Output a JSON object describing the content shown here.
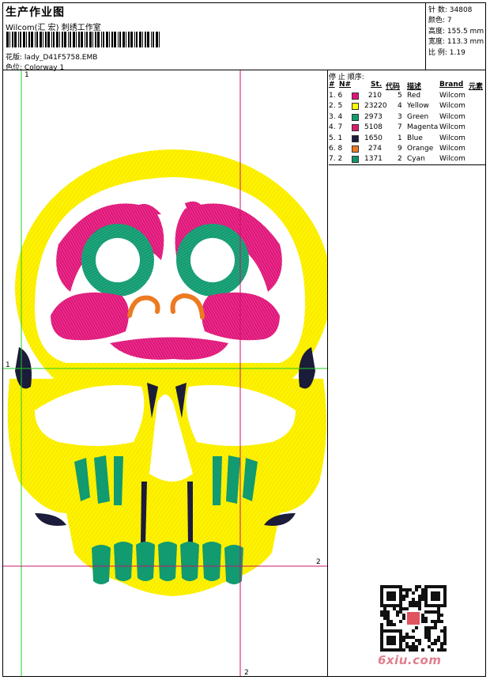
{
  "header": {
    "title": "生产作业图",
    "subtitle": "Wilcom(汇 宏) 刺绣工作室",
    "design_label": "花版:",
    "design_file": "lady_D41F5758.EMB",
    "colorway_label": "色位:",
    "colorway": "Colorway 1"
  },
  "stats": {
    "stitches_label": "针 数:",
    "stitches": "34808",
    "colors_label": "颜色:",
    "colors": "7",
    "height_label": "高度:",
    "height": "155.5 mm",
    "width_label": "宽度:",
    "width": "113.3 mm",
    "scale_label": "比 例:",
    "scale": "1.19"
  },
  "stop_sequence": {
    "title": "停 止 顺序:",
    "columns": [
      "#",
      "N#",
      "St.",
      "代码",
      "描述",
      "Brand",
      "元素"
    ],
    "rows": [
      {
        "idx": "1. 6",
        "color": "#e0157a",
        "stitches": "210",
        "code": "5",
        "desc": "Red",
        "brand": "Wilcom"
      },
      {
        "idx": "2. 5",
        "color": "#ffff00",
        "stitches": "23220",
        "code": "4",
        "desc": "Yellow",
        "brand": "Wilcom"
      },
      {
        "idx": "3. 4",
        "color": "#129a70",
        "stitches": "2973",
        "code": "3",
        "desc": "Green",
        "brand": "Wilcom"
      },
      {
        "idx": "4. 7",
        "color": "#d81b6a",
        "stitches": "5108",
        "code": "7",
        "desc": "Magenta",
        "brand": "Wilcom"
      },
      {
        "idx": "5. 1",
        "color": "#1b1b3a",
        "stitches": "1650",
        "code": "1",
        "desc": "Blue",
        "brand": "Wilcom"
      },
      {
        "idx": "6. 8",
        "color": "#ec7a22",
        "stitches": "274",
        "code": "9",
        "desc": "Orange",
        "brand": "Wilcom"
      },
      {
        "idx": "7. 2",
        "color": "#11936e",
        "stitches": "1371",
        "code": "2",
        "desc": "Cyan",
        "brand": "Wilcom"
      }
    ]
  },
  "guides": {
    "top_label": "1",
    "left_label": "1",
    "right_label": "2",
    "bottom_label": "2"
  },
  "watermark": {
    "site": "6xiu.com"
  },
  "colors": {
    "yellow": "#fff200",
    "magenta": "#e0157a",
    "green": "#129a70",
    "orange": "#ec7a22",
    "dark": "#1b1b3a",
    "guide_green": "#22cc22",
    "guide_magenta": "#c8146e"
  }
}
